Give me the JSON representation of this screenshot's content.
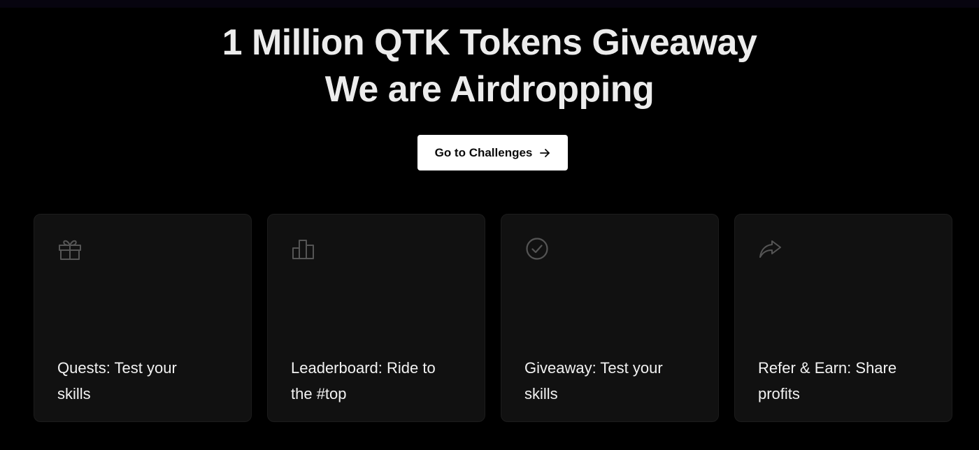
{
  "hero": {
    "headline_line1": "1 Million QTK Tokens Giveaway",
    "headline_line2": "We are Airdropping",
    "cta_label": "Go to Challenges",
    "cta_icon": "arrow-right-icon"
  },
  "cards": [
    {
      "icon": "gift-icon",
      "label": "Quests: Test your skills"
    },
    {
      "icon": "bar-chart-icon",
      "label": "Leaderboard: Ride to the #top"
    },
    {
      "icon": "check-circle-icon",
      "label": "Giveaway: Test your skills"
    },
    {
      "icon": "share-forward-icon",
      "label": "Refer & Earn: Share profits"
    }
  ],
  "colors": {
    "background": "#000000",
    "card_background": "#111111",
    "icon_stroke": "#555555",
    "cta_background": "#ffffff",
    "cta_text": "#0a0a0a",
    "text": "#ececec"
  }
}
